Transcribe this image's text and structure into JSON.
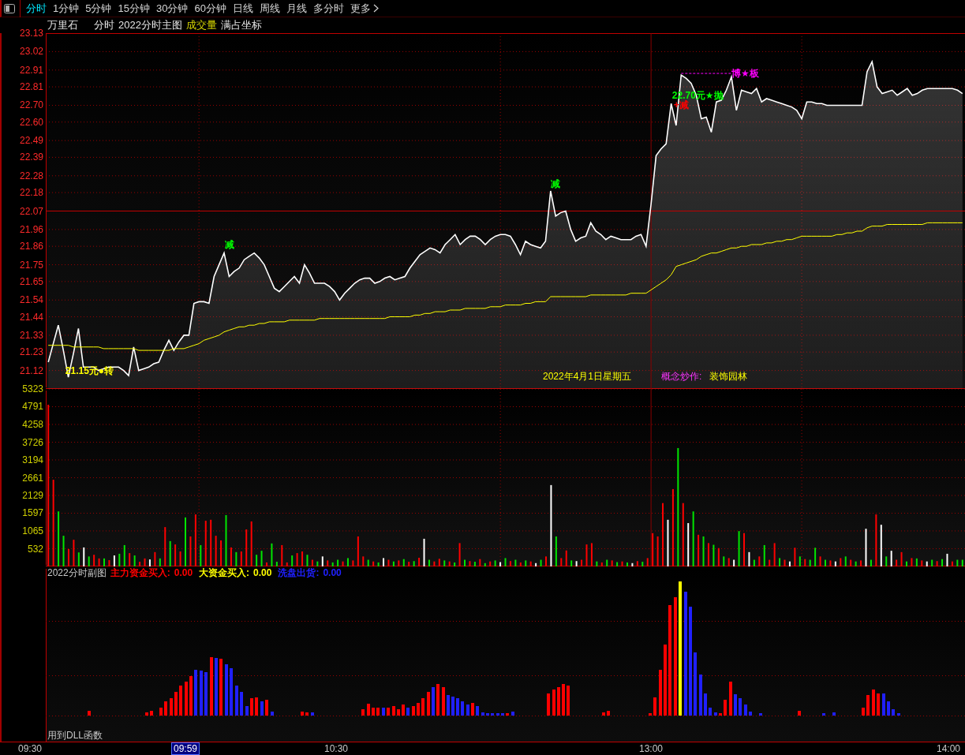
{
  "toolbar": {
    "tabs": [
      {
        "label": "分时",
        "selected": true
      },
      {
        "label": "1分钟",
        "selected": false
      },
      {
        "label": "5分钟",
        "selected": false
      },
      {
        "label": "15分钟",
        "selected": false
      },
      {
        "label": "30分钟",
        "selected": false
      },
      {
        "label": "60分钟",
        "selected": false
      },
      {
        "label": "日线",
        "selected": false
      },
      {
        "label": "周线",
        "selected": false
      },
      {
        "label": "月线",
        "selected": false
      },
      {
        "label": "多分时",
        "selected": false
      }
    ],
    "more_label": "更多"
  },
  "chart_header": {
    "stock_name": "万里石",
    "mode": "分时",
    "main_indicator": "2022分时主图",
    "volume_indicator": "成交量",
    "scale_mode": "满占坐标"
  },
  "price_panel": {
    "chart_data": {
      "type": "area",
      "grid": true,
      "ylim": [
        21.01,
        23.13
      ],
      "ref_lines": [
        {
          "axis": "y",
          "value": 22.07
        }
      ],
      "yticks": [
        21.12,
        21.23,
        21.33,
        21.44,
        21.54,
        21.65,
        21.75,
        21.86,
        21.96,
        22.07,
        22.18,
        22.28,
        22.39,
        22.49,
        {
          "value": 22.6,
          "label": "22.60"
        },
        {
          "value": 22.7,
          "label": "22.70"
        },
        22.81,
        22.91,
        23.02,
        23.13
      ],
      "series": [
        {
          "color": "#ffffff",
          "values": [
            21.17,
            21.28,
            21.39,
            21.24,
            21.08,
            21.22,
            21.37,
            21.14,
            21.14,
            21.14,
            21.12,
            21.13,
            21.14,
            21.14,
            21.14,
            21.12,
            21.09,
            21.26,
            21.12,
            21.13,
            21.14,
            21.16,
            21.17,
            21.24,
            21.3,
            21.24,
            21.29,
            21.33,
            21.33,
            21.52,
            21.53,
            21.53,
            21.52,
            21.68,
            21.75,
            21.82,
            21.68,
            21.71,
            21.73,
            21.78,
            21.8,
            21.82,
            21.79,
            21.75,
            21.68,
            21.61,
            21.59,
            21.62,
            21.65,
            21.68,
            21.64,
            21.75,
            21.7,
            21.64,
            21.64,
            21.64,
            21.62,
            21.59,
            21.54,
            21.58,
            21.61,
            21.64,
            21.66,
            21.67,
            21.67,
            21.64,
            21.65,
            21.67,
            21.68,
            21.66,
            21.67,
            21.68,
            21.73,
            21.77,
            21.81,
            21.83,
            21.85,
            21.84,
            21.82,
            21.87,
            21.9,
            21.93,
            21.87,
            21.9,
            21.92,
            21.92,
            21.9,
            21.87,
            21.9,
            21.92,
            21.93,
            21.93,
            21.92,
            21.87,
            21.81,
            21.89,
            21.87,
            21.86,
            21.85,
            21.89,
            22.19,
            22.04,
            22.06,
            22.07,
            21.96,
            21.89,
            21.91,
            21.92,
            22.0,
            21.95,
            21.93,
            21.9,
            21.92,
            21.91,
            21.9,
            21.9,
            21.9,
            21.92,
            21.93,
            21.86,
            22.11,
            22.4,
            22.44,
            22.47,
            22.71,
            22.58,
            22.88,
            22.86,
            22.83,
            22.76,
            22.62,
            22.63,
            22.54,
            22.72,
            22.73,
            22.79,
            22.87,
            22.67,
            22.79,
            22.78,
            22.77,
            22.8,
            22.72,
            22.74,
            22.73,
            22.72,
            22.71,
            22.7,
            22.69,
            22.67,
            22.62,
            22.72,
            22.72,
            22.71,
            22.71,
            22.7,
            22.7,
            22.7,
            22.7,
            22.7,
            22.7,
            22.7,
            22.7,
            22.9,
            22.96,
            22.81,
            22.77,
            22.78,
            22.79,
            22.76,
            22.78,
            22.8,
            22.76,
            22.77,
            22.79,
            22.8,
            22.8,
            22.8,
            22.8,
            22.8,
            22.8,
            22.79,
            22.77
          ]
        },
        {
          "color": "#ffff00",
          "type": "line",
          "values": [
            21.27,
            21.27,
            21.27,
            21.27,
            21.27,
            21.26,
            21.26,
            21.26,
            21.26,
            21.26,
            21.26,
            21.25,
            21.25,
            21.25,
            21.25,
            21.25,
            21.25,
            21.25,
            21.24,
            21.24,
            21.24,
            21.24,
            21.24,
            21.24,
            21.24,
            21.25,
            21.25,
            21.25,
            21.26,
            21.27,
            21.28,
            21.3,
            21.31,
            21.32,
            21.33,
            21.35,
            21.36,
            21.37,
            21.38,
            21.38,
            21.39,
            21.39,
            21.4,
            21.4,
            21.41,
            21.41,
            21.41,
            21.41,
            21.42,
            21.42,
            21.42,
            21.42,
            21.42,
            21.42,
            21.43,
            21.43,
            21.43,
            21.43,
            21.43,
            21.43,
            21.43,
            21.43,
            21.43,
            21.43,
            21.43,
            21.43,
            21.43,
            21.43,
            21.44,
            21.44,
            21.44,
            21.44,
            21.44,
            21.45,
            21.45,
            21.46,
            21.46,
            21.47,
            21.47,
            21.47,
            21.48,
            21.48,
            21.48,
            21.49,
            21.49,
            21.49,
            21.49,
            21.49,
            21.5,
            21.5,
            21.5,
            21.51,
            21.51,
            21.51,
            21.51,
            21.52,
            21.52,
            21.53,
            21.53,
            21.53,
            21.56,
            21.56,
            21.56,
            21.56,
            21.56,
            21.56,
            21.56,
            21.56,
            21.57,
            21.57,
            21.57,
            21.57,
            21.57,
            21.57,
            21.57,
            21.57,
            21.58,
            21.58,
            21.58,
            21.58,
            21.6,
            21.62,
            21.64,
            21.66,
            21.69,
            21.74,
            21.75,
            21.76,
            21.77,
            21.78,
            21.8,
            21.81,
            21.82,
            21.82,
            21.83,
            21.84,
            21.85,
            21.85,
            21.86,
            21.86,
            21.87,
            21.87,
            21.87,
            21.88,
            21.88,
            21.89,
            21.89,
            21.9,
            21.9,
            21.91,
            21.92,
            21.92,
            21.92,
            21.92,
            21.92,
            21.92,
            21.92,
            21.93,
            21.93,
            21.94,
            21.94,
            21.95,
            21.95,
            21.97,
            21.98,
            21.98,
            21.98,
            21.99,
            21.99,
            21.99,
            21.99,
            21.99,
            21.99,
            21.99,
            21.99,
            22.0,
            22.0,
            22.0,
            22.0,
            22.0,
            22.0,
            22.0,
            22.0
          ]
        }
      ]
    },
    "signals": [
      {
        "text": "21.15元●转",
        "color": "#ffff00",
        "kind": "label"
      },
      {
        "text": "减",
        "color": "#00ff00",
        "kind": "label"
      },
      {
        "text": "减",
        "color": "#00ff00",
        "kind": "label"
      },
      {
        "text": "22.70元★抛",
        "color": "#00ff00",
        "kind": "label"
      },
      {
        "text": "+减",
        "color": "#ff0000",
        "kind": "label"
      },
      {
        "text": "博★板",
        "color": "#ff00ff",
        "kind": "marker"
      }
    ],
    "info": {
      "date": "2022年4月1日星期五",
      "concept_label": "概念炒作:",
      "concept": "装饰园林"
    }
  },
  "volume_panel": {
    "chart_data": {
      "type": "bar",
      "grid": true,
      "ylim": [
        0,
        5323
      ],
      "yticks": [
        532,
        1065,
        1597,
        2129,
        2661,
        3194,
        3726,
        4258,
        4791,
        5323
      ],
      "series": [
        {
          "color": "#ff0000",
          "values": [
            4850,
            2600,
            null,
            null,
            520,
            800,
            null,
            null,
            null,
            350,
            240,
            null,
            190,
            null,
            null,
            null,
            400,
            null,
            140,
            240,
            null,
            430,
            null,
            1180,
            null,
            660,
            450,
            null,
            900,
            1560,
            null,
            1370,
            1400,
            920,
            780,
            null,
            570,
            null,
            450,
            1110,
            1350,
            null,
            null,
            120,
            null,
            null,
            640,
            120,
            null,
            400,
            450,
            null,
            200,
            null,
            null,
            180,
            null,
            null,
            150,
            null,
            180,
            900,
            300,
            null,
            150,
            null,
            null,
            200,
            null,
            180,
            null,
            140,
            null,
            260,
            null,
            null,
            150,
            230,
            null,
            150,
            null,
            700,
            null,
            160,
            null,
            220,
            null,
            150,
            null,
            null,
            null,
            160,
            null,
            120,
            null,
            150,
            null,
            null,
            300,
            null,
            null,
            250,
            480,
            null,
            null,
            200,
            660,
            700,
            null,
            120,
            null,
            180,
            null,
            150,
            null,
            null,
            160,
            null,
            250,
            1000,
            900,
            1900,
            null,
            2320,
            null,
            1900,
            null,
            null,
            950,
            null,
            700,
            null,
            550,
            null,
            250,
            null,
            null,
            1000,
            null,
            null,
            300,
            null,
            200,
            700,
            null,
            200,
            null,
            560,
            null,
            220,
            null,
            null,
            300,
            null,
            180,
            null,
            250,
            null,
            200,
            null,
            180,
            null,
            null,
            1560,
            null,
            null,
            null,
            200,
            430,
            null,
            250,
            null,
            180,
            null,
            null,
            160,
            null,
            null,
            150,
            null,
            null
          ]
        },
        {
          "color": "#00e600",
          "values": [
            null,
            null,
            1650,
            920,
            null,
            null,
            420,
            null,
            300,
            null,
            null,
            240,
            null,
            null,
            380,
            640,
            null,
            330,
            null,
            null,
            null,
            null,
            240,
            null,
            760,
            null,
            null,
            1470,
            null,
            null,
            640,
            null,
            null,
            null,
            null,
            1540,
            null,
            430,
            null,
            null,
            null,
            350,
            470,
            null,
            690,
            140,
            null,
            null,
            330,
            null,
            null,
            350,
            null,
            150,
            null,
            null,
            120,
            200,
            null,
            250,
            null,
            null,
            null,
            200,
            null,
            120,
            null,
            null,
            150,
            null,
            220,
            null,
            160,
            null,
            null,
            200,
            null,
            null,
            180,
            null,
            120,
            null,
            200,
            null,
            140,
            null,
            100,
            null,
            180,
            null,
            250,
            null,
            200,
            null,
            180,
            null,
            null,
            200,
            null,
            null,
            900,
            null,
            null,
            180,
            null,
            null,
            null,
            null,
            150,
            null,
            200,
            null,
            130,
            null,
            120,
            null,
            null,
            140,
            null,
            null,
            null,
            null,
            null,
            null,
            3550,
            null,
            null,
            1650,
            null,
            900,
            null,
            650,
            null,
            300,
            null,
            null,
            1060,
            null,
            null,
            200,
            null,
            640,
            null,
            null,
            250,
            null,
            null,
            null,
            300,
            null,
            200,
            560,
            null,
            200,
            null,
            null,
            null,
            300,
            null,
            150,
            null,
            null,
            200,
            null,
            null,
            300,
            null,
            null,
            null,
            150,
            null,
            240,
            null,
            null,
            200,
            null,
            220,
            null,
            null,
            200,
            200
          ]
        },
        {
          "color": "#ffffff",
          "values": [
            null,
            null,
            null,
            null,
            null,
            null,
            null,
            570,
            null,
            null,
            null,
            null,
            null,
            330,
            null,
            null,
            null,
            null,
            null,
            null,
            210,
            null,
            null,
            null,
            null,
            null,
            null,
            null,
            null,
            null,
            null,
            null,
            null,
            null,
            null,
            null,
            null,
            null,
            null,
            null,
            null,
            null,
            null,
            null,
            null,
            null,
            null,
            null,
            null,
            null,
            null,
            null,
            null,
            null,
            300,
            null,
            null,
            null,
            null,
            null,
            null,
            null,
            null,
            null,
            null,
            null,
            250,
            null,
            null,
            null,
            null,
            null,
            null,
            null,
            830,
            null,
            null,
            null,
            null,
            null,
            null,
            null,
            null,
            null,
            null,
            null,
            null,
            null,
            null,
            130,
            null,
            null,
            null,
            null,
            null,
            null,
            100,
            null,
            null,
            2440,
            null,
            null,
            null,
            null,
            160,
            null,
            null,
            null,
            null,
            null,
            null,
            null,
            null,
            null,
            null,
            100,
            null,
            null,
            null,
            null,
            null,
            null,
            1400,
            null,
            null,
            null,
            1300,
            null,
            null,
            null,
            null,
            null,
            null,
            null,
            null,
            200,
            null,
            null,
            430,
            null,
            null,
            null,
            null,
            null,
            null,
            null,
            150,
            null,
            null,
            null,
            null,
            null,
            null,
            null,
            null,
            150,
            null,
            null,
            null,
            null,
            null,
            1130,
            null,
            null,
            1250,
            null,
            470,
            null,
            null,
            null,
            null,
            null,
            null,
            150,
            null,
            null,
            null,
            380,
            null,
            null,
            null
          ]
        }
      ]
    }
  },
  "sub_panel": {
    "title": "2022分时副图",
    "indicators": [
      {
        "label": "主力资金买入:",
        "value": "0.00",
        "color": "#ff0000"
      },
      {
        "label": "大资金买入:",
        "value": "0.00",
        "color": "#ffff00"
      },
      {
        "label": "洗盘出货:",
        "value": "0.00",
        "color": "#2020ff"
      }
    ],
    "footer": "用到DLL函数"
  },
  "time_axis": [
    {
      "label": "09:30",
      "selected": false
    },
    {
      "label": "09:59",
      "selected": true
    },
    {
      "label": "10:30",
      "selected": false
    },
    {
      "label": "13:00",
      "selected": false
    },
    {
      "label": "14:00",
      "selected": false
    }
  ]
}
